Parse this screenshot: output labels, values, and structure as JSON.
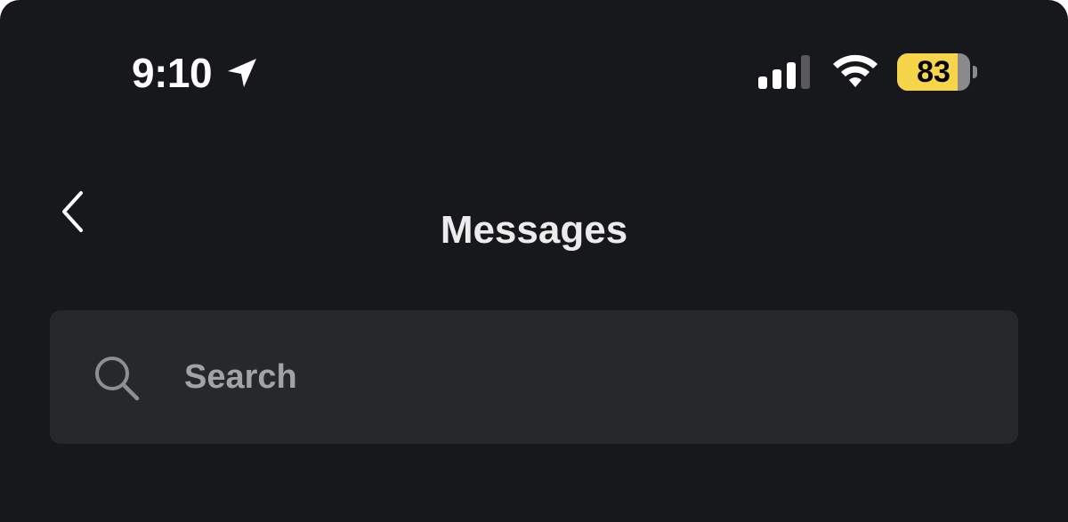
{
  "status_bar": {
    "time": "9:10",
    "location_icon": "location-arrow-icon",
    "signal_icon": "cellular-signal-icon",
    "signal_bars_active": 3,
    "signal_bars_total": 4,
    "wifi_icon": "wifi-icon",
    "battery_level": "83",
    "battery_fraction": 0.83,
    "battery_color": "#f7d54a"
  },
  "nav": {
    "back_icon": "chevron-left-icon",
    "title": "Messages"
  },
  "search": {
    "icon": "search-icon",
    "placeholder": "Search",
    "value": ""
  },
  "colors": {
    "background": "#17181b",
    "search_field": "#27282b",
    "placeholder": "#a2a3a7"
  }
}
